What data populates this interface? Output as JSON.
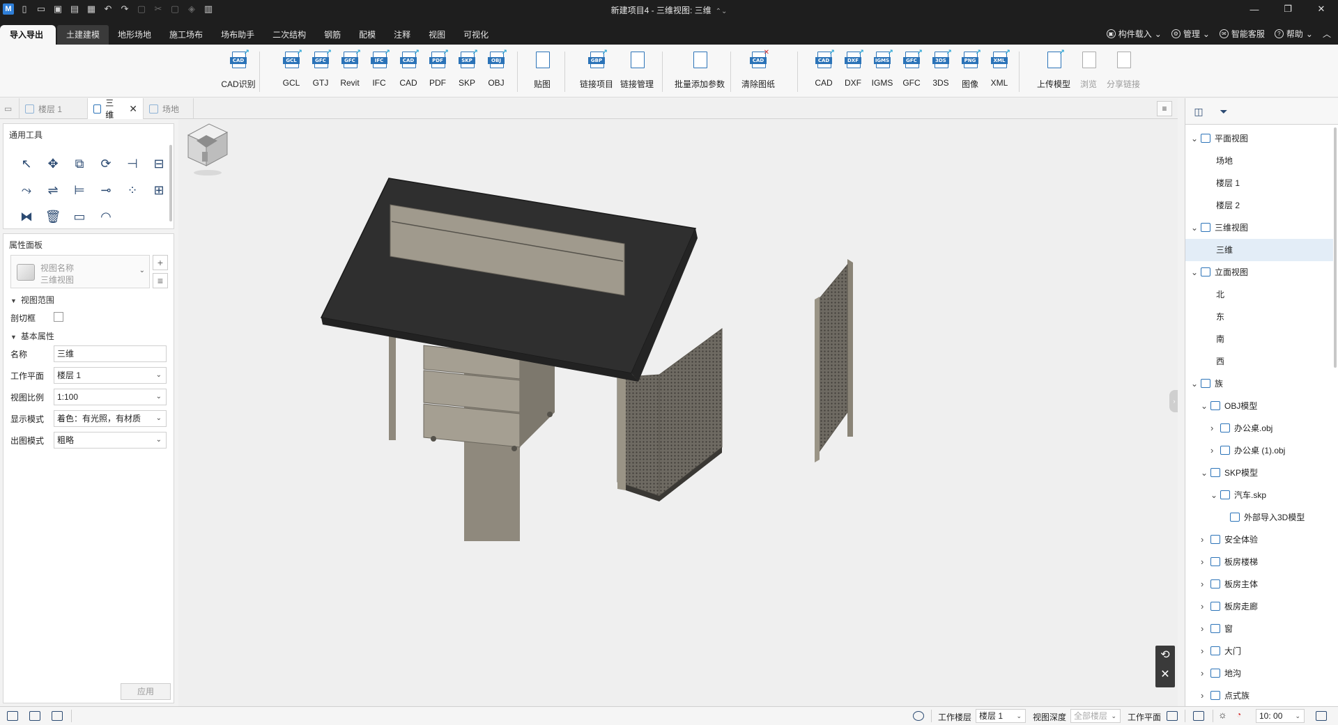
{
  "titlebar": {
    "logo": "M",
    "title": "新建项目4 - 三维视图: 三维",
    "window_controls": [
      "minimize",
      "restore",
      "close"
    ]
  },
  "menu": {
    "tabs": [
      {
        "label": "导入导出",
        "active": true
      },
      {
        "label": "土建建模"
      },
      {
        "label": "地形场地"
      },
      {
        "label": "施工场布"
      },
      {
        "label": "场布助手"
      },
      {
        "label": "二次结构"
      },
      {
        "label": "钢筋"
      },
      {
        "label": "配模"
      },
      {
        "label": "注释"
      },
      {
        "label": "视图"
      },
      {
        "label": "可视化"
      }
    ],
    "right": {
      "component_load": "构件载入",
      "manage": "管理",
      "support": "智能客服",
      "help": "帮助"
    }
  },
  "ribbon": {
    "buttons": [
      {
        "label": "CAD识别",
        "tag": "CAD"
      },
      {
        "label": "GCL",
        "tag": "GCL"
      },
      {
        "label": "GTJ",
        "tag": "GFC"
      },
      {
        "label": "Revit",
        "tag": "GFC"
      },
      {
        "label": "IFC",
        "tag": "IFC"
      },
      {
        "label": "CAD",
        "tag": "CAD"
      },
      {
        "label": "PDF",
        "tag": "PDF"
      },
      {
        "label": "SKP",
        "tag": "SKP"
      },
      {
        "label": "OBJ",
        "tag": "OBJ"
      },
      {
        "label": "贴图",
        "tag": ""
      },
      {
        "label": "链接项目",
        "tag": "GBP"
      },
      {
        "label": "链接管理",
        "tag": ""
      },
      {
        "label": "批量添加参数",
        "tag": ""
      },
      {
        "label": "清除图纸",
        "tag": "CAD"
      },
      {
        "label": "CAD",
        "tag": "CAD"
      },
      {
        "label": "DXF",
        "tag": "DXF"
      },
      {
        "label": "IGMS",
        "tag": "IGMS"
      },
      {
        "label": "GFC",
        "tag": "GFC"
      },
      {
        "label": "3DS",
        "tag": "3DS"
      },
      {
        "label": "图像",
        "tag": "PNG"
      },
      {
        "label": "XML",
        "tag": "XML"
      },
      {
        "label": "上传模型",
        "tag": ""
      },
      {
        "label": "浏览",
        "tag": ""
      },
      {
        "label": "分享链接",
        "tag": ""
      }
    ]
  },
  "doc_tabs": [
    {
      "label": "楼层 1"
    },
    {
      "label": "三维",
      "active": true
    },
    {
      "label": "场地"
    }
  ],
  "tools_panel": {
    "title": "通用工具",
    "tools": [
      "select-tool",
      "move-tool",
      "copy-tool",
      "rotate-tool",
      "trim-tool",
      "split-tool",
      "offset-tool",
      "align-tool",
      "extend-tool",
      "break-tool",
      "array-tool",
      "group-tool",
      "mirror-tool",
      "delete-tool",
      "measure-tool",
      "angle-tool"
    ]
  },
  "props": {
    "title": "属性面板",
    "view_name_label": "视图名称",
    "view_type": "三维视图",
    "section_range": "视图范围",
    "section_box_label": "剖切框",
    "section_basic": "基本属性",
    "rows": [
      {
        "key": "名称",
        "value": "三维"
      },
      {
        "key": "工作平面",
        "value": "楼层 1"
      },
      {
        "key": "视图比例",
        "value": "1:100"
      },
      {
        "key": "显示模式",
        "value": "着色：有光照，有材质"
      },
      {
        "key": "出图模式",
        "value": "粗略"
      }
    ],
    "apply": "应用"
  },
  "tree": {
    "rows": [
      {
        "label": "平面视图",
        "level": 0,
        "expand": "open",
        "icon": true
      },
      {
        "label": "场地",
        "level": 1
      },
      {
        "label": "楼层 1",
        "level": 1
      },
      {
        "label": "楼层 2",
        "level": 1
      },
      {
        "label": "三维视图",
        "level": 0,
        "expand": "open",
        "icon": true
      },
      {
        "label": "三维",
        "level": 1,
        "selected": true
      },
      {
        "label": "立面视图",
        "level": 0,
        "expand": "open",
        "icon": true
      },
      {
        "label": "北",
        "level": 1
      },
      {
        "label": "东",
        "level": 1
      },
      {
        "label": "南",
        "level": 1
      },
      {
        "label": "西",
        "level": 1
      },
      {
        "label": "族",
        "level": 0,
        "expand": "open",
        "icon": true
      },
      {
        "label": "OBJ模型",
        "level": 1,
        "expand": "open",
        "icon": true
      },
      {
        "label": "办公桌.obj",
        "level": 2,
        "expand": "closed",
        "icon": true
      },
      {
        "label": "办公桌 (1).obj",
        "level": 2,
        "expand": "closed",
        "icon": true
      },
      {
        "label": "SKP模型",
        "level": 1,
        "expand": "open",
        "icon": true
      },
      {
        "label": "汽车.skp",
        "level": 2,
        "expand": "open",
        "icon": true
      },
      {
        "label": "外部导入3D模型",
        "level": 3,
        "icon": true
      },
      {
        "label": "安全体验",
        "level": 1,
        "expand": "closed",
        "icon": true
      },
      {
        "label": "板房楼梯",
        "level": 1,
        "expand": "closed",
        "icon": true
      },
      {
        "label": "板房主体",
        "level": 1,
        "expand": "closed",
        "icon": true
      },
      {
        "label": "板房走廊",
        "level": 1,
        "expand": "closed",
        "icon": true
      },
      {
        "label": "窗",
        "level": 1,
        "expand": "closed",
        "icon": true
      },
      {
        "label": "大门",
        "level": 1,
        "expand": "closed",
        "icon": true
      },
      {
        "label": "地沟",
        "level": 1,
        "expand": "closed",
        "icon": true
      },
      {
        "label": "点式族",
        "level": 1,
        "expand": "closed",
        "icon": true
      }
    ]
  },
  "statusbar": {
    "work_floor_label": "工作楼层",
    "work_floor_value": "楼层 1",
    "view_depth_label": "视图深度",
    "view_depth_value": "全部楼层",
    "work_plane_label": "工作平面",
    "time": "10: 00"
  },
  "colors": {
    "dark_chrome": "#1e1e1e",
    "accent": "#2b73b8",
    "desk_top": "#333333",
    "desk_metal": "#8f897d"
  }
}
